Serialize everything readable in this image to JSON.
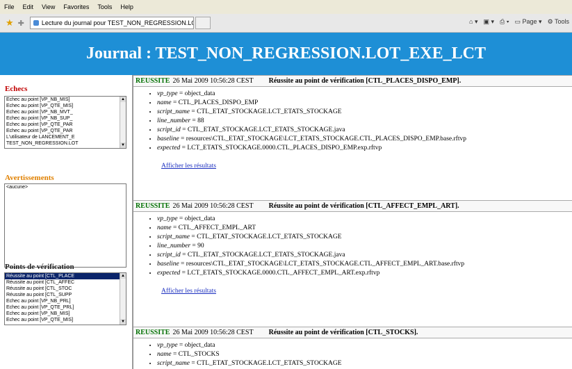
{
  "menu": [
    "File",
    "Edit",
    "View",
    "Favorites",
    "Tools",
    "Help"
  ],
  "tab": {
    "title": "Lecture du journal pour TEST_NON_REGRESSION.LO..."
  },
  "toolbar_right": {
    "page": "Page",
    "tools": "Tools"
  },
  "header": {
    "title": "Journal : TEST_NON_REGRESSION.LOT_EXE_LCT"
  },
  "sidebar": {
    "failures": {
      "title": "Echecs",
      "items": [
        "Echec au point [VP_NB_MIS]",
        "Echec au point [VP_QTE_MIS]",
        "Echec au point [VP_NB_MVT_",
        "Echec au point [VP_NB_SUP_",
        "Echec au point [VP_QTE_PAR",
        "Echec au point [VP_QTE_PAR",
        "L'utilisateur de LANCEMENT_E",
        "TEST_NON_REGRESSION.LOT"
      ]
    },
    "warnings": {
      "title": "Avertissements",
      "items": [
        "<aucune>"
      ]
    },
    "checkpoints": {
      "title": "Points de vérification",
      "items": [
        "Réussite au point [CTL_PLACE",
        "Réussite au point [CTL_AFFEC",
        "Réussite au point [CTL_STOC",
        "Réussite au point [CTL_SUPP",
        "Echec au point [VP_NB_PRL]",
        "Echec au point [VP_QTE_PRL]",
        "Echec au point [VP_NB_MIS]",
        "Echec au point [VP_QTE_MIS]"
      ]
    }
  },
  "entries": [
    {
      "status": "REUSSITE",
      "date": "26 Mai 2009 10:56:28 CEST",
      "message": "Réussite au point de vérification [CTL_PLACES_DISPO_EMP].",
      "props": [
        {
          "key": "vp_type",
          "value": " = object_data"
        },
        {
          "key": "name",
          "value": " = CTL_PLACES_DISPO_EMP"
        },
        {
          "key": "script_name",
          "value": " = CTL_ETAT_STOCKAGE.LCT_ETATS_STOCKAGE"
        },
        {
          "key": "line_number",
          "value": " = 88"
        },
        {
          "key": "script_id",
          "value": " = CTL_ETAT_STOCKAGE.LCT_ETATS_STOCKAGE.java"
        },
        {
          "key": "baseline",
          "value": " = resources\\CTL_ETAT_STOCKAGE\\LCT_ETATS_STOCKAGE.CTL_PLACES_DISPO_EMP.base.rftvp"
        },
        {
          "key": "expected",
          "value": " = LCT_ETATS_STOCKAGE.0000.CTL_PLACES_DISPO_EMP.exp.rftvp"
        }
      ],
      "link": "Afficher les résultats"
    },
    {
      "status": "REUSSITE",
      "date": "26 Mai 2009 10:56:28 CEST",
      "message": "Réussite au point de vérification [CTL_AFFECT_EMPL_ART].",
      "props": [
        {
          "key": "vp_type",
          "value": " = object_data"
        },
        {
          "key": "name",
          "value": " = CTL_AFFECT_EMPL_ART"
        },
        {
          "key": "script_name",
          "value": " = CTL_ETAT_STOCKAGE.LCT_ETATS_STOCKAGE"
        },
        {
          "key": "line_number",
          "value": " = 90"
        },
        {
          "key": "script_id",
          "value": " = CTL_ETAT_STOCKAGE.LCT_ETATS_STOCKAGE.java"
        },
        {
          "key": "baseline",
          "value": " = resources\\CTL_ETAT_STOCKAGE\\LCT_ETATS_STOCKAGE.CTL_AFFECT_EMPL_ART.base.rftvp"
        },
        {
          "key": "expected",
          "value": " = LCT_ETATS_STOCKAGE.0000.CTL_AFFECT_EMPL_ART.exp.rftvp"
        }
      ],
      "link": "Afficher les résultats"
    },
    {
      "status": "REUSSITE",
      "date": "26 Mai 2009 10:56:28 CEST",
      "message": "Réussite au point de vérification [CTL_STOCKS].",
      "props": [
        {
          "key": "vp_type",
          "value": " = object_data"
        },
        {
          "key": "name",
          "value": " = CTL_STOCKS"
        },
        {
          "key": "script_name",
          "value": " = CTL_ETAT_STOCKAGE.LCT_ETATS_STOCKAGE"
        }
      ]
    }
  ]
}
